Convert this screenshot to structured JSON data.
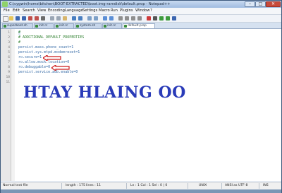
{
  "window": {
    "title": "C:\\cygwin\\home\\bitchen\\BOOT-EXTRACTED\\boot.img-ramdisk\\default.prop - Notepad++",
    "controls": {
      "minimize": "–",
      "maximize": "□",
      "close": "✕"
    }
  },
  "menu": [
    "File",
    "Edit",
    "Search",
    "View",
    "Encoding",
    "Language",
    "Settings",
    "Macro",
    "Run",
    "Plugins",
    "Window",
    "?"
  ],
  "tabs": [
    {
      "label": "superboot.sh"
    },
    {
      "label": "init.rc"
    },
    {
      "label": "init.rc"
    },
    {
      "label": "system.sh"
    },
    {
      "label": "init.rc"
    },
    {
      "label": "default.prop",
      "active": true
    }
  ],
  "editor": {
    "line_numbers": [
      "1",
      "2",
      "3",
      "4",
      "5",
      "6",
      "7",
      "8",
      "9",
      "10",
      "11"
    ],
    "lines": [
      "#",
      "# ADDITIONAL_DEFAULT_PROPERTIES",
      "#",
      "persist.mass.phone_count=1",
      "persist.sys.mtpd.modemreset=1",
      "ro.secure=1",
      "ro.allow.mock.location=0",
      "ro.debuggable=0",
      "persist.service.adb.enable=0",
      "",
      ""
    ]
  },
  "watermark": "HTAY HLAING OO",
  "status": {
    "file_type": "Normal text file",
    "length": "length : 175",
    "lines": "lines : 11",
    "position": "Ln : 1    Col : 1    Sel : 0 | 0",
    "eol": "UNIX",
    "encoding": "ANSI as UTF-8",
    "mode": "INS"
  },
  "colors": {
    "arrow": "#cc1a1a",
    "watermark": "#2a3bb8"
  }
}
